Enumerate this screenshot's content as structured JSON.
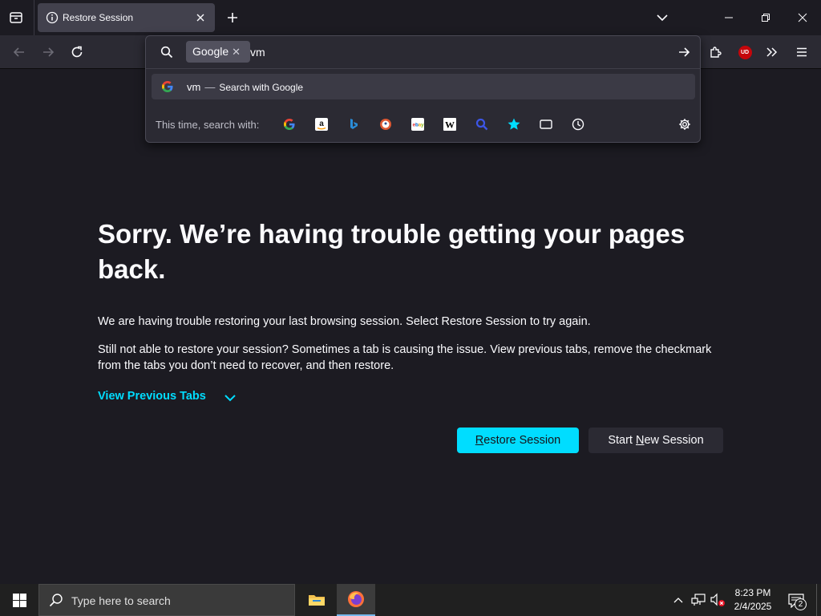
{
  "tab": {
    "title": "Restore Session"
  },
  "urlbar": {
    "engine_chip": "Google",
    "chip_close": "✕",
    "query": "vm",
    "suggestion": {
      "query": "vm",
      "dash": "—",
      "action": "Search with Google"
    },
    "oneoff_label": "This time, search with:",
    "oneoff_engines": [
      "Google",
      "Amazon",
      "Bing",
      "DuckDuckGo",
      "eBay",
      "Wikipedia",
      "Search",
      "Bookmarks",
      "Tabs",
      "History"
    ]
  },
  "toolbar": {
    "ublock_badge": "UD"
  },
  "content": {
    "title": "Sorry. We’re having trouble getting your pages back.",
    "paragraph1": "We are having trouble restoring your last browsing session. Select Restore Session to try again.",
    "paragraph2": "Still not able to restore your session? Sometimes a tab is causing the issue. View previous tabs, remove the checkmark from the tabs you don’t need to recover, and then restore.",
    "view_tabs_link": "View Previous Tabs",
    "restore_button": {
      "before": "",
      "accesskey": "R",
      "after": "estore Session"
    },
    "new_session_button": {
      "before": "Start ",
      "accesskey": "N",
      "after": "ew Session"
    }
  },
  "taskbar": {
    "search_placeholder": "Type here to search",
    "time": "8:23 PM",
    "date": "2/4/2025",
    "notification_count": "2"
  },
  "colors": {
    "accent": "#00ddff",
    "background": "#1c1b22",
    "toolbar": "#2b2a33"
  }
}
